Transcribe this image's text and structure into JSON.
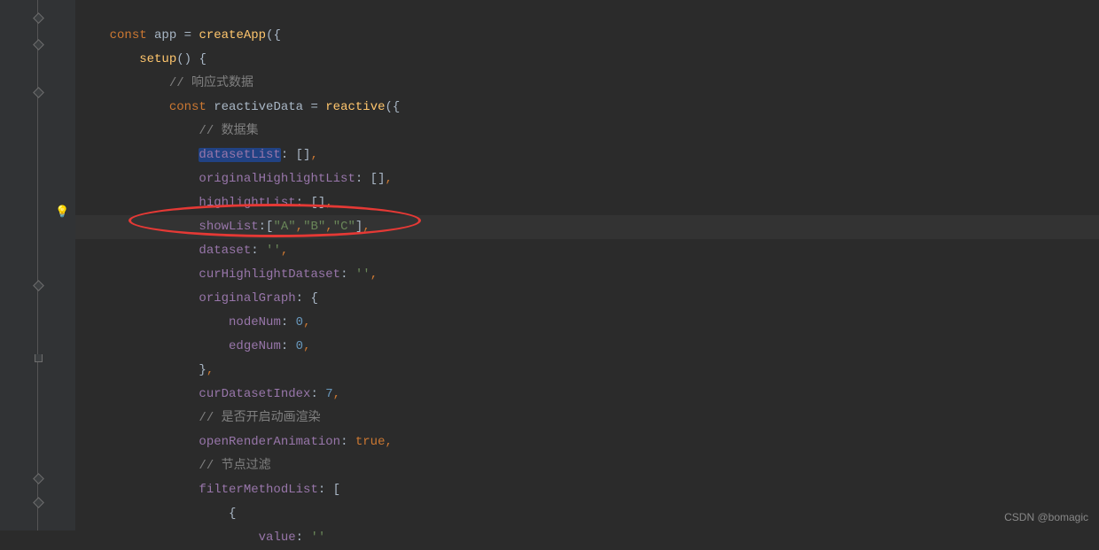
{
  "watermark": "CSDN @bomagic",
  "code": {
    "line0": {
      "kw1": "const",
      "var1": " app ",
      "op": "= ",
      "func": "createApp",
      "paren": "({"
    },
    "line1": {
      "func": "setup",
      "parens": "() {"
    },
    "line2": {
      "comment": "// 响应式数据"
    },
    "line3": {
      "kw1": "const",
      "var1": " reactiveData ",
      "op": "= ",
      "func": "reactive",
      "paren": "({"
    },
    "line4": {
      "comment": "// 数据集"
    },
    "line5": {
      "prop": "datasetList",
      "after": ": []",
      "comma": ","
    },
    "line6": {
      "prop": "originalHighlightList",
      "after": ": []",
      "comma": ","
    },
    "line7": {
      "prop": "highlightList",
      "after": ": []",
      "comma": ","
    },
    "line8": {
      "prop": "showList",
      "colon": ":",
      "b1": "[",
      "s1": "\"A\"",
      "c1": ",",
      "s2": "\"B\"",
      "c2": ",",
      "s3": "\"C\"",
      "b2": "]",
      "comma": ","
    },
    "line9": {
      "prop": "dataset",
      "after": ": ",
      "str": "''",
      "comma": ","
    },
    "line10": {
      "prop": "curHighlightDataset",
      "after": ": ",
      "str": "''",
      "comma": ","
    },
    "line11": {
      "prop": "originalGraph",
      "after": ": {"
    },
    "line12": {
      "prop": "nodeNum",
      "after": ": ",
      "num": "0",
      "comma": ","
    },
    "line13": {
      "prop": "edgeNum",
      "after": ": ",
      "num": "0",
      "comma": ","
    },
    "line14": {
      "brace": "}",
      "comma": ","
    },
    "line15": {
      "prop": "curDatasetIndex",
      "after": ": ",
      "num": "7",
      "comma": ","
    },
    "line16": {
      "comment": "// 是否开启动画渲染"
    },
    "line17": {
      "prop": "openRenderAnimation",
      "after": ": ",
      "bool": "true",
      "comma": ","
    },
    "line18": {
      "comment": "// 节点过滤"
    },
    "line19": {
      "prop": "filterMethodList",
      "after": ": ["
    },
    "line20": {
      "brace": "{"
    },
    "line21": {
      "prop": "value",
      "after": ": ",
      "str": "''"
    }
  }
}
